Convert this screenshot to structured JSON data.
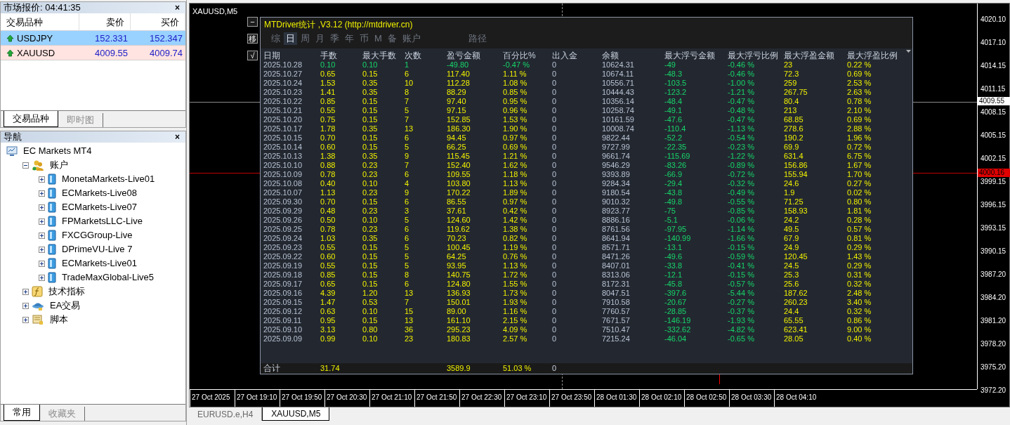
{
  "market_watch": {
    "title": "市场报价: 04:41:35",
    "close": "×",
    "columns": [
      "交易品种",
      "卖价",
      "买价"
    ],
    "rows": [
      {
        "symbol": "USDJPY",
        "bid": "152.331",
        "ask": "152.347",
        "selected": true
      },
      {
        "symbol": "XAUUSD",
        "bid": "4009.55",
        "ask": "4009.74",
        "selected": false
      }
    ],
    "tabs": [
      {
        "label": "交易品种",
        "selected": true
      },
      {
        "label": "即时图",
        "selected": false
      }
    ]
  },
  "navigator": {
    "title": "导航",
    "close": "×",
    "tree": [
      {
        "label": "EC Markets MT4",
        "kind": "terminal",
        "children": [
          {
            "label": "账户",
            "kind": "accounts",
            "expanded": true,
            "children": [
              {
                "label": "MonetaMarkets-Live01",
                "kind": "server",
                "expanded": false
              },
              {
                "label": "ECMarkets-Live08",
                "kind": "server",
                "expanded": false
              },
              {
                "label": "ECMarkets-Live07",
                "kind": "server",
                "expanded": false
              },
              {
                "label": "FPMarketsLLC-Live",
                "kind": "server",
                "expanded": false
              },
              {
                "label": "FXCGGroup-Live",
                "kind": "server",
                "expanded": false
              },
              {
                "label": "DPrimeVU-Live 7",
                "kind": "server",
                "expanded": false
              },
              {
                "label": "ECMarkets-Live01",
                "kind": "server",
                "expanded": false
              },
              {
                "label": "TradeMaxGlobal-Live5",
                "kind": "server",
                "expanded": false
              }
            ]
          },
          {
            "label": "技术指标",
            "kind": "indicators",
            "expanded": false
          },
          {
            "label": "EA交易",
            "kind": "experts",
            "expanded": false
          },
          {
            "label": "脚本",
            "kind": "scripts",
            "expanded": false
          }
        ]
      }
    ],
    "tabs": [
      {
        "label": "常用",
        "selected": true
      },
      {
        "label": "收藏夹",
        "selected": false
      }
    ]
  },
  "chart": {
    "title": "XAUUSD,M5",
    "price_axis": [
      "4020.10",
      "4017.10",
      "4014.15",
      "4011.15",
      "4008.15",
      "4005.15",
      "4002.15",
      "3999.15",
      "3996.15",
      "3993.15",
      "3990.15",
      "3987.20",
      "3984.20",
      "3981.20",
      "3978.20",
      "3975.20",
      "3972.20"
    ],
    "price_tags": [
      {
        "label": "4009.55",
        "kind": "bid"
      },
      {
        "label": "4000.16",
        "kind": "marker"
      }
    ],
    "time_axis": [
      "27 Oct 2025",
      "27 Oct 19:10",
      "27 Oct 19:50",
      "27 Oct 20:30",
      "27 Oct 21:10",
      "27 Oct 21:50",
      "27 Oct 22:30",
      "27 Oct 23:10",
      "27 Oct 23:50",
      "28 Oct 01:30",
      "28 Oct 02:10",
      "28 Oct 02:50",
      "28 Oct 03:30",
      "28 Oct 04:10"
    ],
    "side_buttons": [
      "−",
      "移",
      "√"
    ]
  },
  "stats": {
    "title": "MTDriver统计 ,V3.12 (http://mtdriver.cn)",
    "tabs": [
      {
        "label": "综",
        "selected": false
      },
      {
        "label": "日",
        "selected": true
      },
      {
        "label": "周",
        "selected": false
      },
      {
        "label": "月",
        "selected": false
      },
      {
        "label": "季",
        "selected": false
      },
      {
        "label": "年",
        "selected": false
      },
      {
        "label": "币",
        "selected": false
      },
      {
        "label": "M",
        "selected": false
      },
      {
        "label": "备",
        "selected": false
      },
      {
        "label": "账户",
        "selected": false
      },
      {
        "label": "路径",
        "selected": false
      }
    ],
    "columns": [
      "日期",
      "手数",
      "最大手数",
      "次数",
      "盈亏金额",
      "百分比%",
      "出入金",
      "余额",
      "最大浮亏金额",
      "最大浮亏比例",
      "最大浮盈金额",
      "最大浮盈比例"
    ],
    "rows": [
      {
        "loss": true,
        "cells": [
          "2025.10.28",
          "0.10",
          "0.10",
          "1",
          "-49.80",
          "-0.47 %",
          "0",
          "10624.31",
          "-49",
          "-0.46 %",
          "23",
          "0.22 %"
        ]
      },
      {
        "loss": false,
        "cells": [
          "2025.10.27",
          "0.65",
          "0.15",
          "6",
          "117.40",
          "1.11 %",
          "0",
          "10674.11",
          "-48.3",
          "-0.46 %",
          "72.3",
          "0.69 %"
        ]
      },
      {
        "loss": false,
        "cells": [
          "2025.10.24",
          "1.53",
          "0.35",
          "10",
          "112.28",
          "1.08 %",
          "0",
          "10556.71",
          "-103.5",
          "-1.00 %",
          "259",
          "2.53 %"
        ]
      },
      {
        "loss": false,
        "cells": [
          "2025.10.23",
          "1.41",
          "0.35",
          "8",
          "88.29",
          "0.85 %",
          "0",
          "10444.43",
          "-123.2",
          "-1.21 %",
          "267.75",
          "2.63 %"
        ]
      },
      {
        "loss": false,
        "cells": [
          "2025.10.22",
          "0.85",
          "0.15",
          "7",
          "97.40",
          "0.95 %",
          "0",
          "10356.14",
          "-48.4",
          "-0.47 %",
          "80.4",
          "0.78 %"
        ]
      },
      {
        "loss": false,
        "cells": [
          "2025.10.21",
          "0.55",
          "0.15",
          "5",
          "97.15",
          "0.96 %",
          "0",
          "10258.74",
          "-49.1",
          "-0.48 %",
          "213",
          "2.10 %"
        ]
      },
      {
        "loss": false,
        "cells": [
          "2025.10.20",
          "0.75",
          "0.15",
          "7",
          "152.85",
          "1.53 %",
          "0",
          "10161.59",
          "-47.6",
          "-0.47 %",
          "68.85",
          "0.69 %"
        ]
      },
      {
        "loss": false,
        "cells": [
          "2025.10.17",
          "1.78",
          "0.35",
          "13",
          "186.30",
          "1.90 %",
          "0",
          "10008.74",
          "-110.4",
          "-1.13 %",
          "278.6",
          "2.88 %"
        ]
      },
      {
        "loss": false,
        "cells": [
          "2025.10.15",
          "0.70",
          "0.15",
          "6",
          "94.45",
          "0.97 %",
          "0",
          "9822.44",
          "-52.2",
          "-0.54 %",
          "190.2",
          "1.96 %"
        ]
      },
      {
        "loss": false,
        "cells": [
          "2025.10.14",
          "0.60",
          "0.15",
          "5",
          "66.25",
          "0.69 %",
          "0",
          "9727.99",
          "-22.35",
          "-0.23 %",
          "69.9",
          "0.72 %"
        ]
      },
      {
        "loss": false,
        "cells": [
          "2025.10.13",
          "1.38",
          "0.35",
          "9",
          "115.45",
          "1.21 %",
          "0",
          "9661.74",
          "-115.69",
          "-1.22 %",
          "631.4",
          "6.75 %"
        ]
      },
      {
        "loss": false,
        "cells": [
          "2025.10.10",
          "0.88",
          "0.23",
          "7",
          "152.40",
          "1.62 %",
          "0",
          "9546.29",
          "-83.26",
          "-0.89 %",
          "156.86",
          "1.67 %"
        ]
      },
      {
        "loss": false,
        "cells": [
          "2025.10.09",
          "0.78",
          "0.23",
          "6",
          "109.55",
          "1.18 %",
          "0",
          "9393.89",
          "-66.9",
          "-0.72 %",
          "155.94",
          "1.70 %"
        ]
      },
      {
        "loss": false,
        "cells": [
          "2025.10.08",
          "0.40",
          "0.10",
          "4",
          "103.80",
          "1.13 %",
          "0",
          "9284.34",
          "-29.4",
          "-0.32 %",
          "24.6",
          "0.27 %"
        ]
      },
      {
        "loss": false,
        "cells": [
          "2025.10.07",
          "1.13",
          "0.23",
          "9",
          "170.22",
          "1.89 %",
          "0",
          "9180.54",
          "-43.8",
          "-0.49 %",
          "1.9",
          "0.02 %"
        ]
      },
      {
        "loss": false,
        "cells": [
          "2025.09.30",
          "0.70",
          "0.15",
          "6",
          "86.55",
          "0.97 %",
          "0",
          "9010.32",
          "-49.8",
          "-0.55 %",
          "71.25",
          "0.80 %"
        ]
      },
      {
        "loss": false,
        "cells": [
          "2025.09.29",
          "0.48",
          "0.23",
          "3",
          "37.61",
          "0.42 %",
          "0",
          "8923.77",
          "-75",
          "-0.85 %",
          "158.93",
          "1.81 %"
        ]
      },
      {
        "loss": false,
        "cells": [
          "2025.09.26",
          "0.50",
          "0.10",
          "5",
          "124.60",
          "1.42 %",
          "0",
          "8886.16",
          "-5.1",
          "-0.06 %",
          "24.2",
          "0.28 %"
        ]
      },
      {
        "loss": false,
        "cells": [
          "2025.09.25",
          "0.78",
          "0.23",
          "6",
          "119.62",
          "1.38 %",
          "0",
          "8761.56",
          "-97.95",
          "-1.14 %",
          "49.5",
          "0.57 %"
        ]
      },
      {
        "loss": false,
        "cells": [
          "2025.09.24",
          "1.03",
          "0.35",
          "6",
          "70.23",
          "0.82 %",
          "0",
          "8641.94",
          "-140.99",
          "-1.66 %",
          "67.9",
          "0.81 %"
        ]
      },
      {
        "loss": false,
        "cells": [
          "2025.09.23",
          "0.55",
          "0.15",
          "5",
          "100.45",
          "1.19 %",
          "0",
          "8571.71",
          "-13.1",
          "-0.15 %",
          "24.9",
          "0.29 %"
        ]
      },
      {
        "loss": false,
        "cells": [
          "2025.09.22",
          "0.60",
          "0.15",
          "5",
          "64.25",
          "0.76 %",
          "0",
          "8471.26",
          "-49.6",
          "-0.59 %",
          "120.45",
          "1.43 %"
        ]
      },
      {
        "loss": false,
        "cells": [
          "2025.09.19",
          "0.55",
          "0.15",
          "5",
          "93.95",
          "1.13 %",
          "0",
          "8407.01",
          "-33.8",
          "-0.41 %",
          "24.5",
          "0.29 %"
        ]
      },
      {
        "loss": false,
        "cells": [
          "2025.09.18",
          "0.85",
          "0.15",
          "8",
          "140.75",
          "1.72 %",
          "0",
          "8313.06",
          "-12.1",
          "-0.15 %",
          "25.3",
          "0.31 %"
        ]
      },
      {
        "loss": false,
        "cells": [
          "2025.09.17",
          "0.65",
          "0.15",
          "6",
          "124.80",
          "1.55 %",
          "0",
          "8172.31",
          "-45.8",
          "-0.57 %",
          "25.6",
          "0.32 %"
        ]
      },
      {
        "loss": false,
        "cells": [
          "2025.09.16",
          "4.39",
          "1.20",
          "13",
          "136.93",
          "1.73 %",
          "0",
          "8047.51",
          "-397.6",
          "-5.44 %",
          "187.62",
          "2.48 %"
        ]
      },
      {
        "loss": false,
        "cells": [
          "2025.09.15",
          "1.47",
          "0.53",
          "7",
          "150.01",
          "1.93 %",
          "0",
          "7910.58",
          "-20.67",
          "-0.27 %",
          "260.23",
          "3.40 %"
        ]
      },
      {
        "loss": false,
        "cells": [
          "2025.09.12",
          "0.63",
          "0.10",
          "15",
          "89.00",
          "1.16 %",
          "0",
          "7760.57",
          "-28.85",
          "-0.37 %",
          "24.4",
          "0.32 %"
        ]
      },
      {
        "loss": false,
        "cells": [
          "2025.09.11",
          "0.95",
          "0.15",
          "13",
          "161.10",
          "2.15 %",
          "0",
          "7671.57",
          "-146.19",
          "-1.93 %",
          "65.55",
          "0.86 %"
        ]
      },
      {
        "loss": false,
        "cells": [
          "2025.09.10",
          "3.13",
          "0.80",
          "36",
          "295.23",
          "4.09 %",
          "0",
          "7510.47",
          "-332.62",
          "-4.82 %",
          "623.41",
          "9.00 %"
        ]
      },
      {
        "loss": false,
        "cells": [
          "2025.09.09",
          "0.99",
          "0.10",
          "23",
          "180.83",
          "2.57 %",
          "0",
          "7215.24",
          "-46.04",
          "-0.65 %",
          "28.05",
          "0.40 %"
        ]
      }
    ],
    "total": {
      "label": "合计",
      "lots": "31.74",
      "pnl": "3589.9",
      "percent": "51.03 %",
      "deposit": "0"
    }
  },
  "chart_tabs": [
    {
      "label": "EURUSD.e,H4",
      "selected": false
    },
    {
      "label": "XAUUSD,M5",
      "selected": true
    }
  ]
}
